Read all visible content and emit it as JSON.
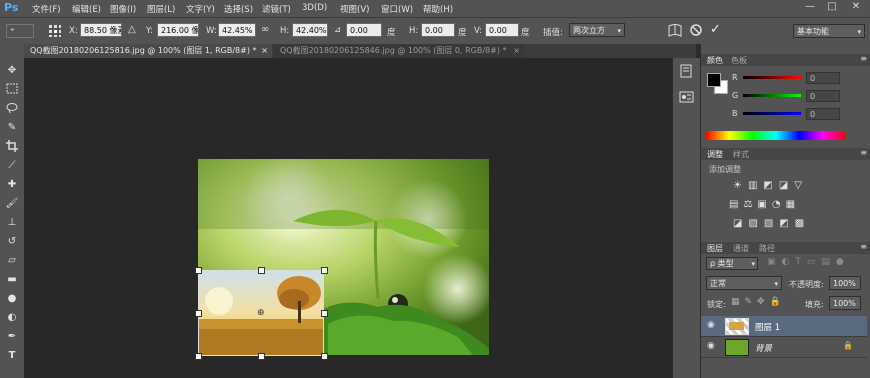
{
  "app": {
    "logo": "Ps"
  },
  "menu": [
    "文件(F)",
    "编辑(E)",
    "图像(I)",
    "图层(L)",
    "文字(Y)",
    "选择(S)",
    "滤镜(T)",
    "3D(D)",
    "视图(V)",
    "窗口(W)",
    "帮助(H)"
  ],
  "window_controls": [
    "—",
    "□",
    "✕"
  ],
  "options": {
    "x_label": "X:",
    "x_value": "88.50 像素",
    "y_label": "Y:",
    "y_value": "216.00 像素",
    "w_label": "W:",
    "w_value": "42.45%",
    "h_label": "H:",
    "h_value": "42.40%",
    "angle_value": "0.00",
    "deg1": "度",
    "h_skew_label": "H:",
    "h_skew_value": "0.00",
    "deg2": "度",
    "v_skew_label": "V:",
    "v_skew_value": "0.00",
    "deg3": "度",
    "interp_label": "插值:",
    "interp_value": "两次立方",
    "workspace": "基本功能"
  },
  "tabs": [
    {
      "label": "QQ截图20180206125816.jpg @ 100% (图层 1, RGB/8#) *",
      "close": "×"
    },
    {
      "label": "QQ截图20180206125846.jpg @ 100% (图层 0, RGB/8#) *",
      "close": "×"
    }
  ],
  "panels": {
    "color": {
      "tab1": "颜色",
      "tab2": "色板",
      "r_label": "R",
      "g_label": "G",
      "b_label": "B",
      "r_value": "0",
      "g_value": "0",
      "b_value": "0"
    },
    "adjust": {
      "tab1": "调整",
      "tab2": "样式",
      "title": "添加调整"
    },
    "layers": {
      "tab1": "图层",
      "tab2": "通道",
      "tab3": "路径",
      "filter_kind": "ρ 类型",
      "blend_mode": "正常",
      "opacity_label": "不透明度:",
      "opacity_value": "100%",
      "lock_label": "锁定:",
      "fill_label": "填充:",
      "fill_value": "100%",
      "items": [
        {
          "name": "图层 1",
          "selected": true
        },
        {
          "name": "背景",
          "selected": false
        }
      ]
    }
  },
  "colors": {
    "accent": "#4fb3ff",
    "ui_bg": "#535353",
    "canvas_bg": "#282828",
    "selected_layer": "#5a6b80"
  }
}
